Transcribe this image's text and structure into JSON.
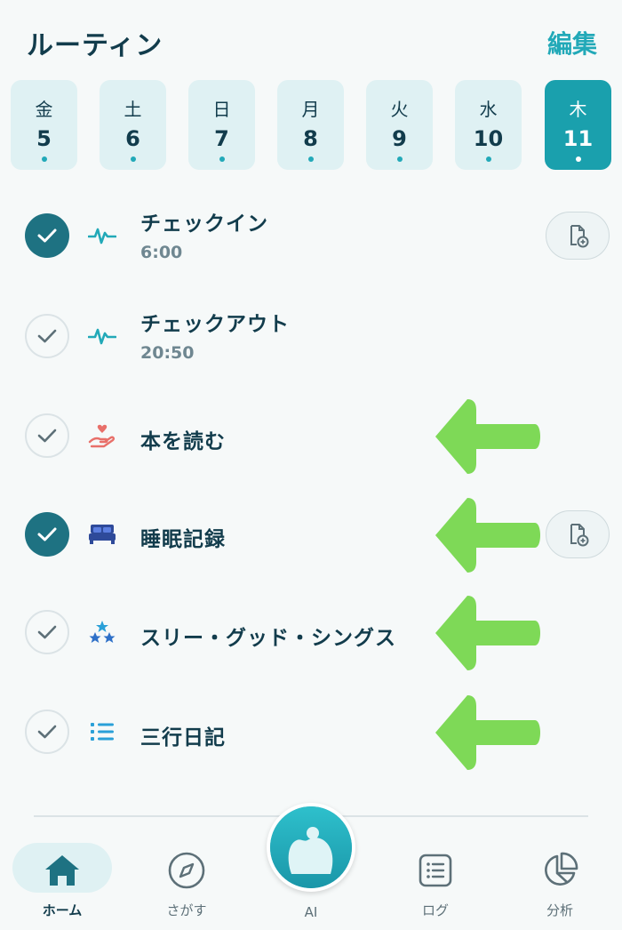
{
  "header": {
    "title": "ルーティン",
    "edit_label": "編集"
  },
  "days": [
    {
      "dow": "金",
      "num": "5",
      "active": false
    },
    {
      "dow": "土",
      "num": "6",
      "active": false
    },
    {
      "dow": "日",
      "num": "7",
      "active": false
    },
    {
      "dow": "月",
      "num": "8",
      "active": false
    },
    {
      "dow": "火",
      "num": "9",
      "active": false
    },
    {
      "dow": "水",
      "num": "10",
      "active": false
    },
    {
      "dow": "木",
      "num": "11",
      "active": true
    }
  ],
  "routines": [
    {
      "label": "チェックイン",
      "time": "6:00",
      "done": true,
      "icon": "pulse-icon",
      "has_note_button": true
    },
    {
      "label": "チェックアウト",
      "time": "20:50",
      "done": false,
      "icon": "pulse-icon",
      "has_note_button": false
    },
    {
      "label": "本を読む",
      "done": false,
      "icon": "heart-hand-icon",
      "has_note_button": false,
      "arrow": true
    },
    {
      "label": "睡眠記録",
      "done": true,
      "icon": "bed-icon",
      "has_note_button": true,
      "arrow": true
    },
    {
      "label": "スリー・グッド・シングス",
      "done": false,
      "icon": "stars-icon",
      "has_note_button": false,
      "arrow": true
    },
    {
      "label": "三行日記",
      "done": false,
      "icon": "list-icon",
      "has_note_button": false,
      "arrow": true
    }
  ],
  "nav": {
    "home": "ホーム",
    "explore": "さがす",
    "ai": "AI",
    "log": "ログ",
    "analysis": "分析"
  },
  "colors": {
    "accent": "#22a9b8",
    "dark": "#123c4c",
    "check_done": "#1e7282",
    "arrow": "#7ed957"
  }
}
